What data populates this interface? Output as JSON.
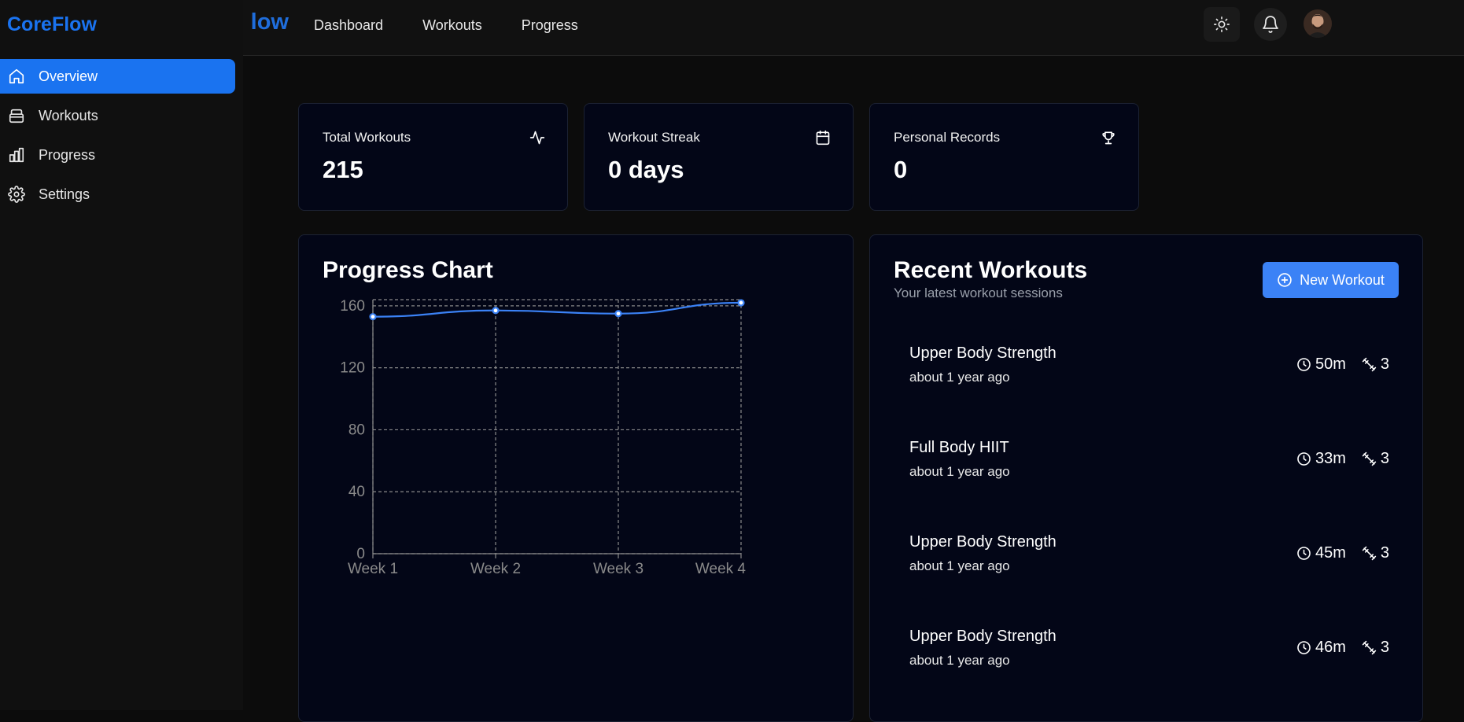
{
  "app": {
    "name": "CoreFlow",
    "header_brand_fragment": "low",
    "accent": "#1a73f0"
  },
  "topnav": {
    "items": [
      {
        "label": "Dashboard"
      },
      {
        "label": "Workouts"
      },
      {
        "label": "Progress"
      }
    ]
  },
  "sidebar": {
    "items": [
      {
        "label": "Overview",
        "icon": "home-icon",
        "active": true
      },
      {
        "label": "Workouts",
        "icon": "dumbbell-icon",
        "active": false
      },
      {
        "label": "Progress",
        "icon": "bar-chart-icon",
        "active": false
      },
      {
        "label": "Settings",
        "icon": "gear-icon",
        "active": false
      }
    ]
  },
  "stats": [
    {
      "label": "Total Workouts",
      "value": "215",
      "icon": "activity-icon"
    },
    {
      "label": "Workout Streak",
      "value": "0 days",
      "icon": "calendar-icon"
    },
    {
      "label": "Personal Records",
      "value": "0",
      "icon": "trophy-icon"
    }
  ],
  "progress": {
    "title": "Progress Chart"
  },
  "chart_data": {
    "type": "line",
    "categories": [
      "Week 1",
      "Week 2",
      "Week 3",
      "Week 4"
    ],
    "series": [
      {
        "values": [
          153,
          157,
          155,
          162
        ]
      }
    ],
    "y_ticks": [
      0,
      40,
      80,
      120,
      160
    ],
    "ylim": [
      0,
      164
    ],
    "grid": true,
    "color": "#3b82f6"
  },
  "recent": {
    "title": "Recent Workouts",
    "subtitle": "Your latest workout sessions",
    "new_button": "New Workout",
    "items": [
      {
        "name": "Upper Body Strength",
        "time": "about 1 year ago",
        "duration": "50m",
        "exercises": "3"
      },
      {
        "name": "Full Body HIIT",
        "time": "about 1 year ago",
        "duration": "33m",
        "exercises": "3"
      },
      {
        "name": "Upper Body Strength",
        "time": "about 1 year ago",
        "duration": "45m",
        "exercises": "3"
      },
      {
        "name": "Upper Body Strength",
        "time": "about 1 year ago",
        "duration": "46m",
        "exercises": "3"
      }
    ]
  }
}
